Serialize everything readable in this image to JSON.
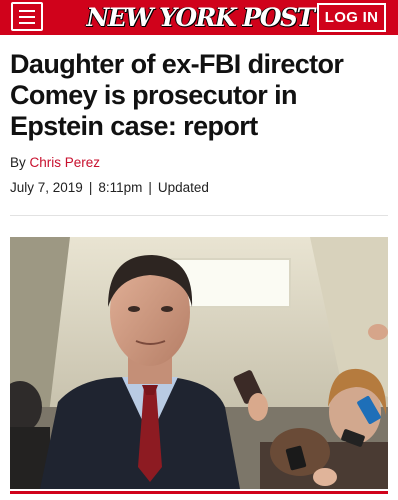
{
  "header": {
    "logo_text": "NEW YORK POST",
    "login_label": "LOG IN",
    "brand_color": "#d0021b",
    "menu_icon": "hamburger-menu-icon"
  },
  "article": {
    "headline": "Daughter of ex-FBI director Comey is prosecutor in Epstein case: report",
    "byline_prefix": "By",
    "author": "Chris Perez",
    "date": "July 7, 2019",
    "time": "8:11pm",
    "separator": "|",
    "updated_label": "Updated"
  },
  "photo": {
    "subject": "man in dark suit and red tie surrounded by reporters with phones"
  }
}
